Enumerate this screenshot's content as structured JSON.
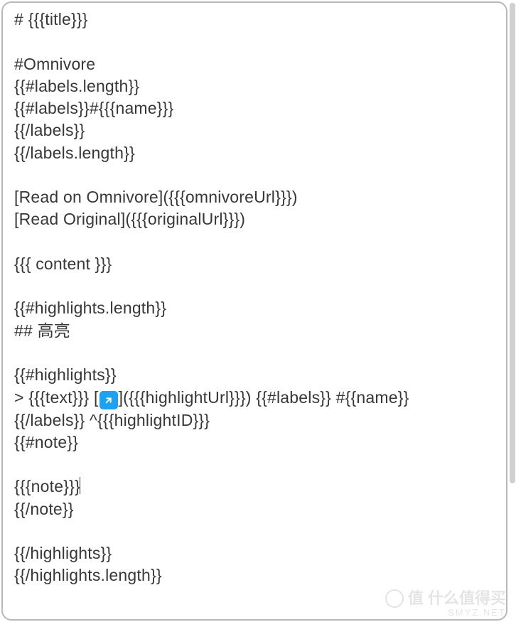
{
  "template": {
    "lines": [
      "# {{{title}}}",
      "",
      "#Omnivore",
      "{{#labels.length}}",
      "{{#labels}}#{{{name}}}",
      "{{/labels}}",
      "{{/labels.length}}",
      "",
      "[Read on Omnivore]({{{omnivoreUrl}}})",
      "[Read Original]({{{originalUrl}}})",
      "",
      "{{{ content }}}",
      "",
      "{{#highlights.length}}",
      "## 高亮",
      "",
      "{{#highlights}}"
    ],
    "highlight_prefix": "> {{{text}}} [",
    "highlight_suffix": "]({{{highlightUrl}}}) {{#labels}} #{{name}}",
    "lines_after": [
      "{{/labels}} ^{{{highlightID}}}",
      "{{#note}}",
      "",
      "{{{note}}}",
      "{{/note}}",
      "",
      "{{/highlights}}",
      "{{/highlights.length}}"
    ]
  },
  "icon": {
    "name": "link-arrow-icon"
  },
  "watermark": {
    "chinese": "值 什么值得买",
    "url": "SMYZ.NET"
  }
}
